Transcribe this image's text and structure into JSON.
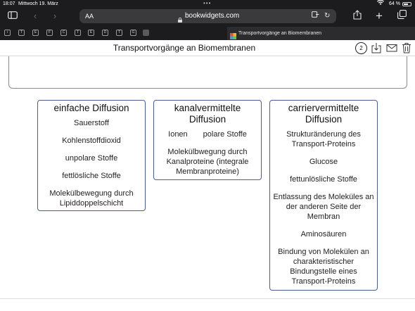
{
  "status": {
    "time": "18:07",
    "date": "Mittwoch 19. März",
    "battery_text": "64 %",
    "battery_level": 0.64
  },
  "browser": {
    "aa_label": "AA",
    "url": "bookwidgets.com",
    "tab_title": "Transportvorgänge an Biomembranen",
    "favicons": [
      "i",
      "T",
      "E",
      "F",
      "C",
      "T",
      "E",
      "D",
      "T",
      "G"
    ]
  },
  "page": {
    "title": "Transportvorgänge an Biomembranen",
    "counter": "2"
  },
  "columns": [
    {
      "title": "einfache Diffusion",
      "items": [
        "Sauerstoff",
        "Kohlenstoffdioxid",
        "unpolare Stoffe",
        "fettlösliche Stoffe",
        "Molekülbewegung durch Lipiddoppelschicht"
      ]
    },
    {
      "title": "kanalvermittelte Diffusion",
      "row_items": [
        "Ionen",
        "polare Stoffe"
      ],
      "items": [
        "Molekülbwegung durch Kanalproteine (integrale Membranproteine)"
      ]
    },
    {
      "title": "carriervermittelte Diffusion",
      "items": [
        "Strukturänderung des Transport-Proteins",
        "Glucose",
        "fettunlösliche Stoffe",
        "Entlassung des Moleküles an der anderen Seite der Membran",
        "Aminosäuren",
        "Bindung von Molekülen an charakteristischer Bindungstelle eines Transport-Proteins"
      ]
    }
  ],
  "icons": {
    "sidebar": "sidebar-icon",
    "back": "chevron-left-icon",
    "forward": "chevron-right-icon",
    "lock": "lock-icon",
    "reader": "reader-icon",
    "reload": "reload-icon",
    "share": "share-icon",
    "new_tab": "plus-icon",
    "tabs": "tabs-icon",
    "download": "download-icon",
    "email": "mail-icon",
    "trash": "trash-icon"
  }
}
